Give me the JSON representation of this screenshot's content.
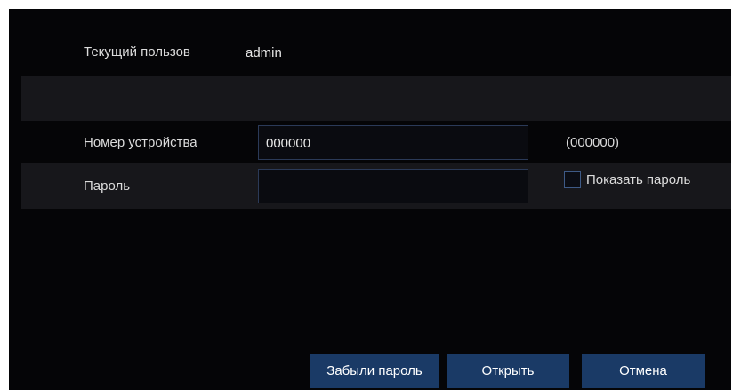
{
  "current_user": {
    "label": "Текущий пользов",
    "value": "admin"
  },
  "device_number": {
    "label": "Номер устройства",
    "value": "000000",
    "hint": "(000000)"
  },
  "password": {
    "label": "Пароль",
    "value": "",
    "show_password_label": "Показать пароль",
    "show_password_checked": false
  },
  "buttons": {
    "forgot_password": "Забыли пароль",
    "open": "Открыть",
    "cancel": "Отмена"
  },
  "colors": {
    "background": "#050507",
    "stripe": "#17171b",
    "button": "#1a3a66",
    "input_border": "#2b3a58"
  }
}
